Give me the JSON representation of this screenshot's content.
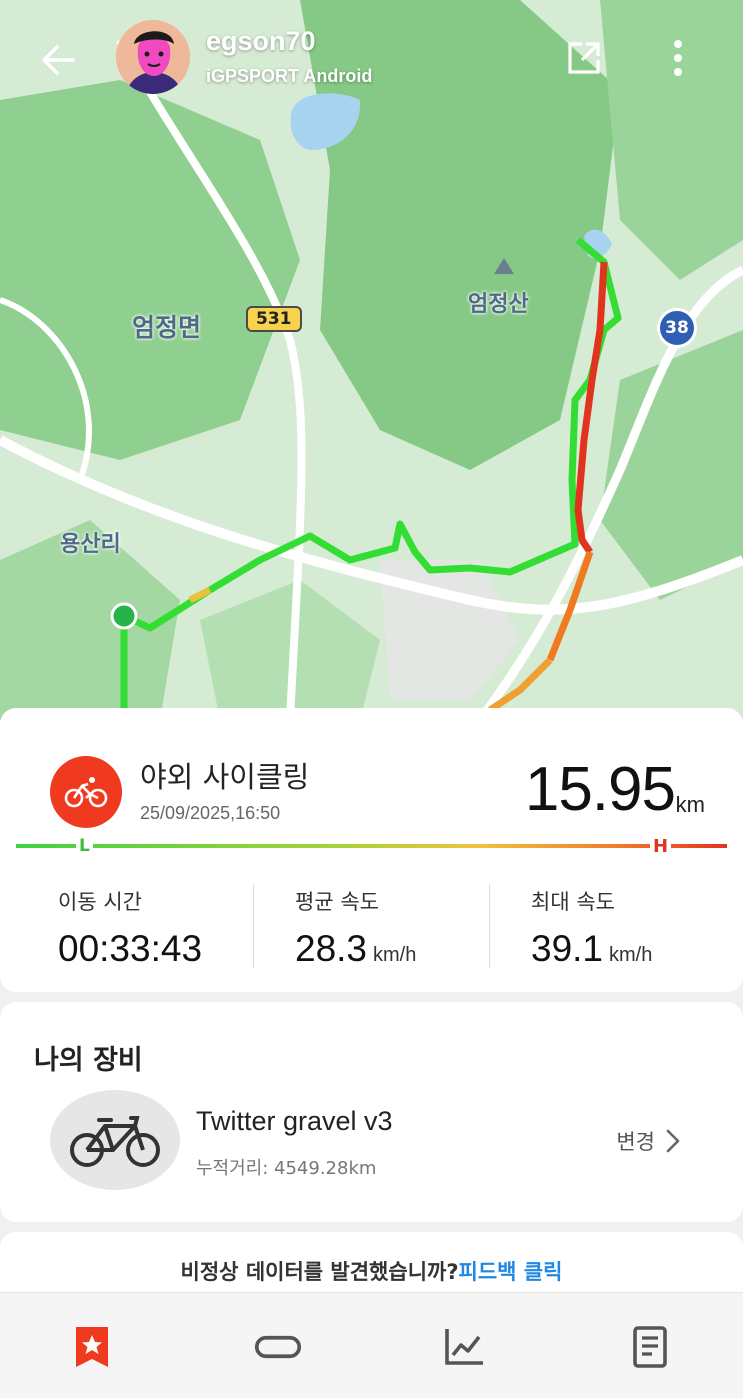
{
  "header": {
    "username": "egson70",
    "device": "iGPSPORT Android",
    "back_icon": "arrow-left-icon",
    "share_icon": "share-external-icon",
    "more_icon": "more-vertical-icon"
  },
  "map": {
    "labels": {
      "town": "엄정면",
      "mountain": "엄정산",
      "village": "용산리"
    },
    "road_531": "531",
    "route_38": "38"
  },
  "summary": {
    "activity_type": "야외 사이클링",
    "datetime": "25/09/2025,16:50",
    "distance": "15.95",
    "distance_unit": "km",
    "speed_low_label": "L",
    "speed_high_label": "H",
    "stats": [
      {
        "label": "이동 시간",
        "value": "00:33:43",
        "unit": ""
      },
      {
        "label": "평균 속도",
        "value": "28.3",
        "unit": "km/h"
      },
      {
        "label": "최대 속도",
        "value": "39.1",
        "unit": "km/h"
      }
    ]
  },
  "gear": {
    "title": "나의 장비",
    "bike_name": "Twitter gravel v3",
    "distance_label": "누적거리: 4549.28km",
    "change_label": "변경"
  },
  "feedback": {
    "text": "비정상 데이터를 발견했습니까?",
    "link": "피드백 클릭"
  },
  "bottom_nav": [
    {
      "icon": "bookmark-star-icon",
      "active": true
    },
    {
      "icon": "loop-icon",
      "active": false
    },
    {
      "icon": "chart-line-icon",
      "active": false
    },
    {
      "icon": "document-icon",
      "active": false
    }
  ],
  "colors": {
    "accent": "#f03a1f",
    "link": "#1e88e5",
    "route_low": "#33dd33",
    "route_high": "#e0341f"
  }
}
